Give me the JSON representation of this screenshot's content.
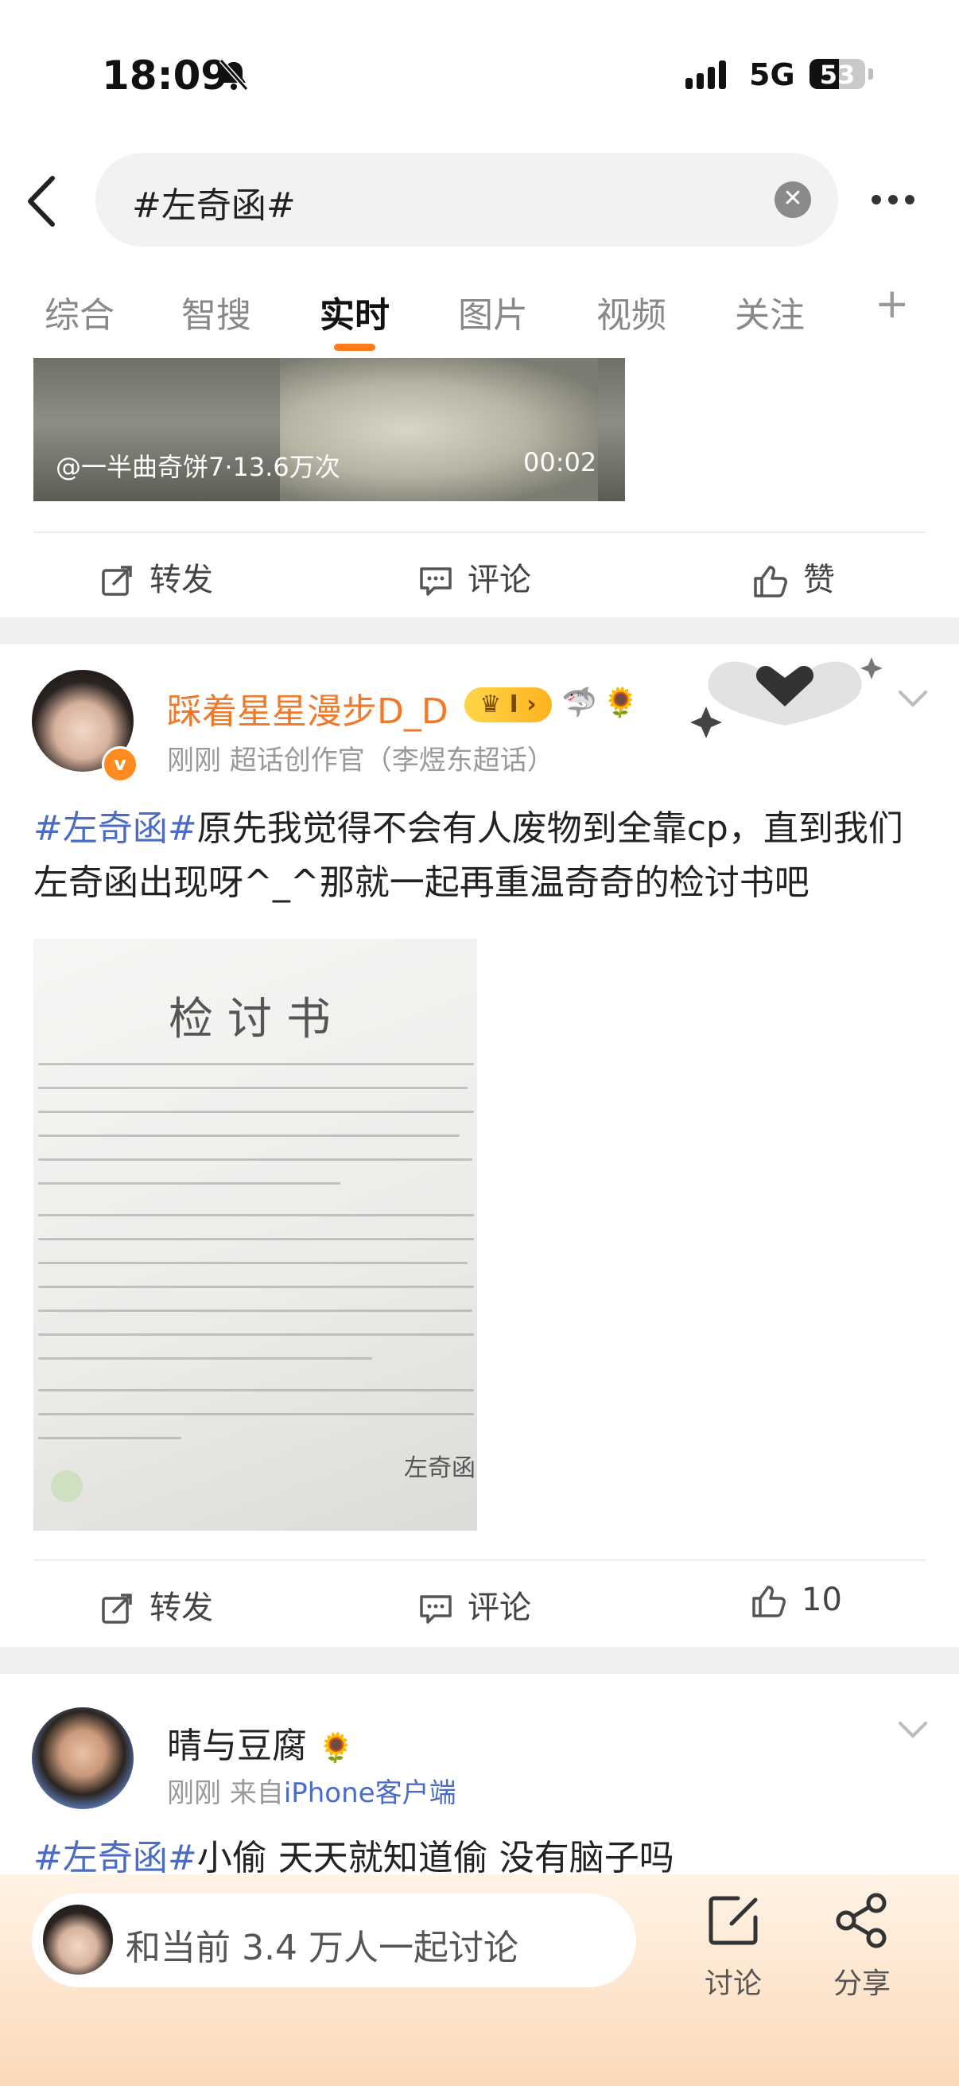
{
  "status_bar": {
    "time": "18:09",
    "network": "5G",
    "battery": "53",
    "battery_level": 0.53
  },
  "search": {
    "query": "#左奇函#"
  },
  "tabs": [
    {
      "label": "综合"
    },
    {
      "label": "智搜"
    },
    {
      "label": "实时",
      "active": true
    },
    {
      "label": "图片"
    },
    {
      "label": "视频"
    },
    {
      "label": "关注"
    }
  ],
  "tab_add": "+",
  "video": {
    "meta": "@一半曲奇饼7·13.6万次",
    "duration": "00:02"
  },
  "action_bar_1": {
    "repost": "转发",
    "comment": "评论",
    "like": "赞"
  },
  "post1": {
    "username": "踩着星星漫步D_D",
    "level_badge": "I",
    "time": "刚刚",
    "source": "超话创作官（李煜东超话）",
    "topic": "#左奇函#",
    "text": "原先我觉得不会有人废物到全靠cp，直到我们左奇函出现呀^_^那就一起再重温奇奇的检讨书吧",
    "letter_title": "检讨书",
    "letter_signature": "左奇函",
    "actions": {
      "repost": "转发",
      "comment": "评论",
      "likes": "10"
    }
  },
  "post2": {
    "username": "晴与豆腐",
    "time": "刚刚",
    "source_prefix": "来自",
    "source": "iPhone客户端",
    "topic": "#左奇函#",
    "text": "小偷 天天就知道偷 没有脑子吗"
  },
  "bottom_bar": {
    "discuss_prompt": "和当前 3.4 万人一起讨论",
    "discuss_label": "讨论",
    "share_label": "分享"
  },
  "colors": {
    "accent": "#ff7a1a",
    "topic": "#4a6cc7",
    "username_vip": "#f0792a"
  }
}
